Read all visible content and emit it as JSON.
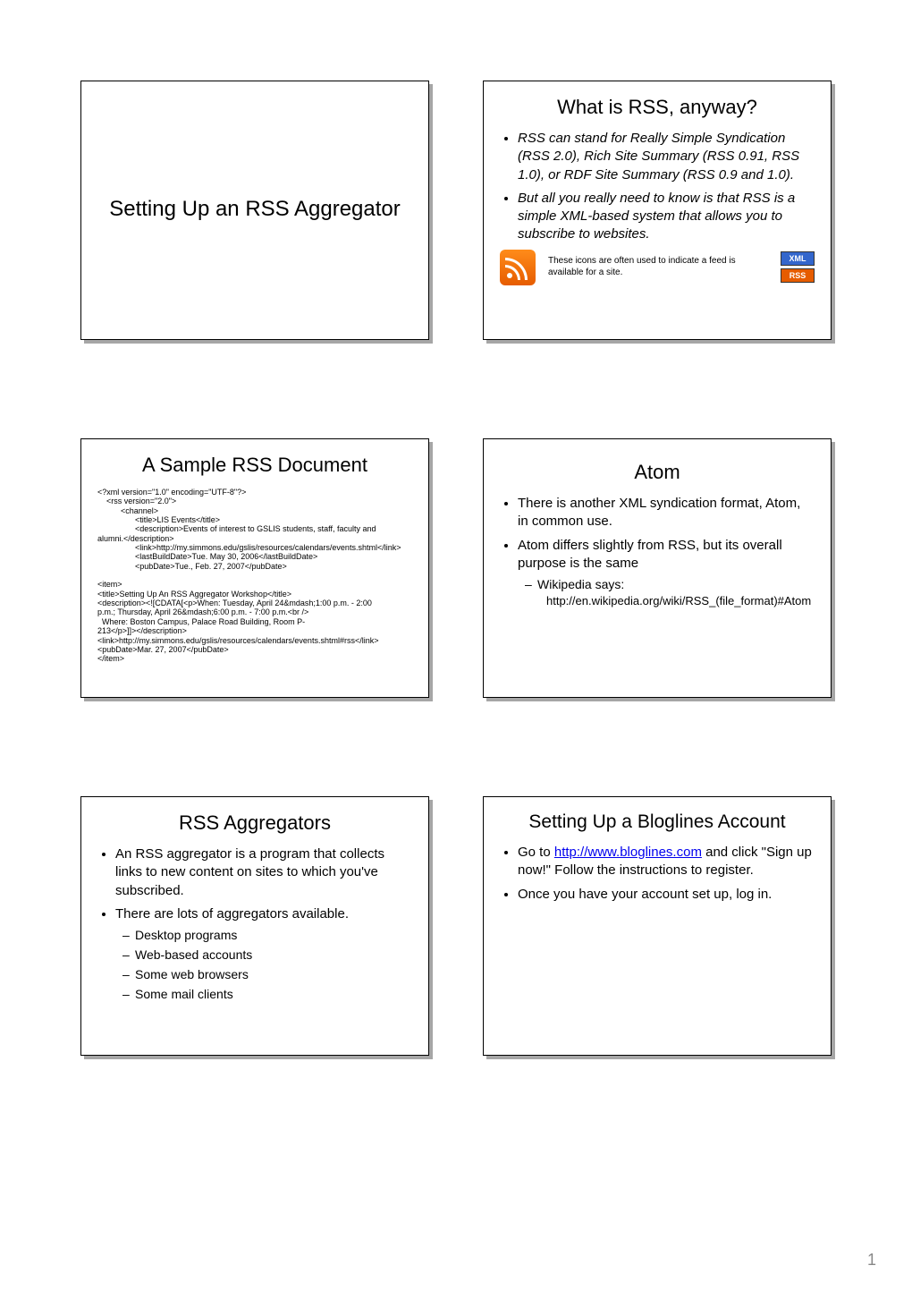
{
  "page_number": "1",
  "slides": {
    "s1": {
      "title": "Setting Up an RSS Aggregator"
    },
    "s2": {
      "title": "What is RSS, anyway?",
      "bullets": [
        "RSS can stand for Really Simple Syndication (RSS 2.0), Rich Site Summary (RSS 0.91, RSS 1.0), or RDF Site Summary (RSS 0.9 and 1.0).",
        "But all you really need to know is that RSS is a simple XML-based system that allows you to subscribe to websites."
      ],
      "icon_caption": "These icons are often used to indicate a feed is available for a site.",
      "badge_xml": "XML",
      "badge_rss": "RSS"
    },
    "s3": {
      "title": "A Sample RSS Document",
      "code_lines": [
        {
          "t": "<?xml version=\"1.0\" encoding=\"UTF-8\"?>",
          "cls": ""
        },
        {
          "t": "<rss version=\"2.0\">",
          "cls": "indent1"
        },
        {
          "t": "<channel>",
          "cls": "indent2"
        },
        {
          "t": "<title>LIS Events</title>",
          "cls": "indent3"
        },
        {
          "t": "<description>Events of interest to GSLIS students, staff, faculty and",
          "cls": "indent3"
        },
        {
          "t": "alumni.</description>",
          "cls": ""
        },
        {
          "t": "<link>http://my.simmons.edu/gslis/resources/calendars/events.shtml</link>",
          "cls": "indent3"
        },
        {
          "t": "<lastBuildDate>Tue. May 30, 2006</lastBuildDate>",
          "cls": "indent3"
        },
        {
          "t": "<pubDate>Tue., Feb. 27, 2007</pubDate>",
          "cls": "indent3"
        },
        {
          "t": "",
          "cls": ""
        },
        {
          "t": "<item>",
          "cls": ""
        },
        {
          "t": "<title>Setting Up An RSS Aggregator Workshop</title>",
          "cls": ""
        },
        {
          "t": "<description><![CDATA[<p>When: Tuesday, April 24&mdash;1:00 p.m. - 2:00",
          "cls": ""
        },
        {
          "t": "p.m.; Thursday, April 26&mdash;6:00 p.m. - 7:00 p.m.<br />",
          "cls": ""
        },
        {
          "t": "  Where: Boston Campus, Palace Road Building, Room P-",
          "cls": ""
        },
        {
          "t": "213</p>]]></description>",
          "cls": ""
        },
        {
          "t": "<link>http://my.simmons.edu/gslis/resources/calendars/events.shtml#rss</link>",
          "cls": ""
        },
        {
          "t": "<pubDate>Mar. 27, 2007</pubDate>",
          "cls": ""
        },
        {
          "t": "</item>",
          "cls": ""
        }
      ]
    },
    "s4": {
      "title": "Atom",
      "bullets": [
        "There is another XML syndication format, Atom, in common use.",
        "Atom differs slightly from RSS, but its overall purpose is the same"
      ],
      "sub_label": "Wikipedia says:",
      "sub_link": "http://en.wikipedia.org/wiki/RSS_(file_format)#Atom"
    },
    "s5": {
      "title": "RSS Aggregators",
      "bullets": [
        "An RSS aggregator is a program that collects links to new content on sites to which you've subscribed.",
        "There are lots of aggregators available."
      ],
      "subs": [
        "Desktop programs",
        "Web-based accounts",
        "Some web browsers",
        "Some mail clients"
      ]
    },
    "s6": {
      "title": "Setting Up a Bloglines Account",
      "b1_pre": "Go to ",
      "b1_link": "http://www.bloglines.com",
      "b1_post": " and click \"Sign up now!\" Follow the instructions to register.",
      "b2": "Once you have your account set up, log in."
    }
  }
}
